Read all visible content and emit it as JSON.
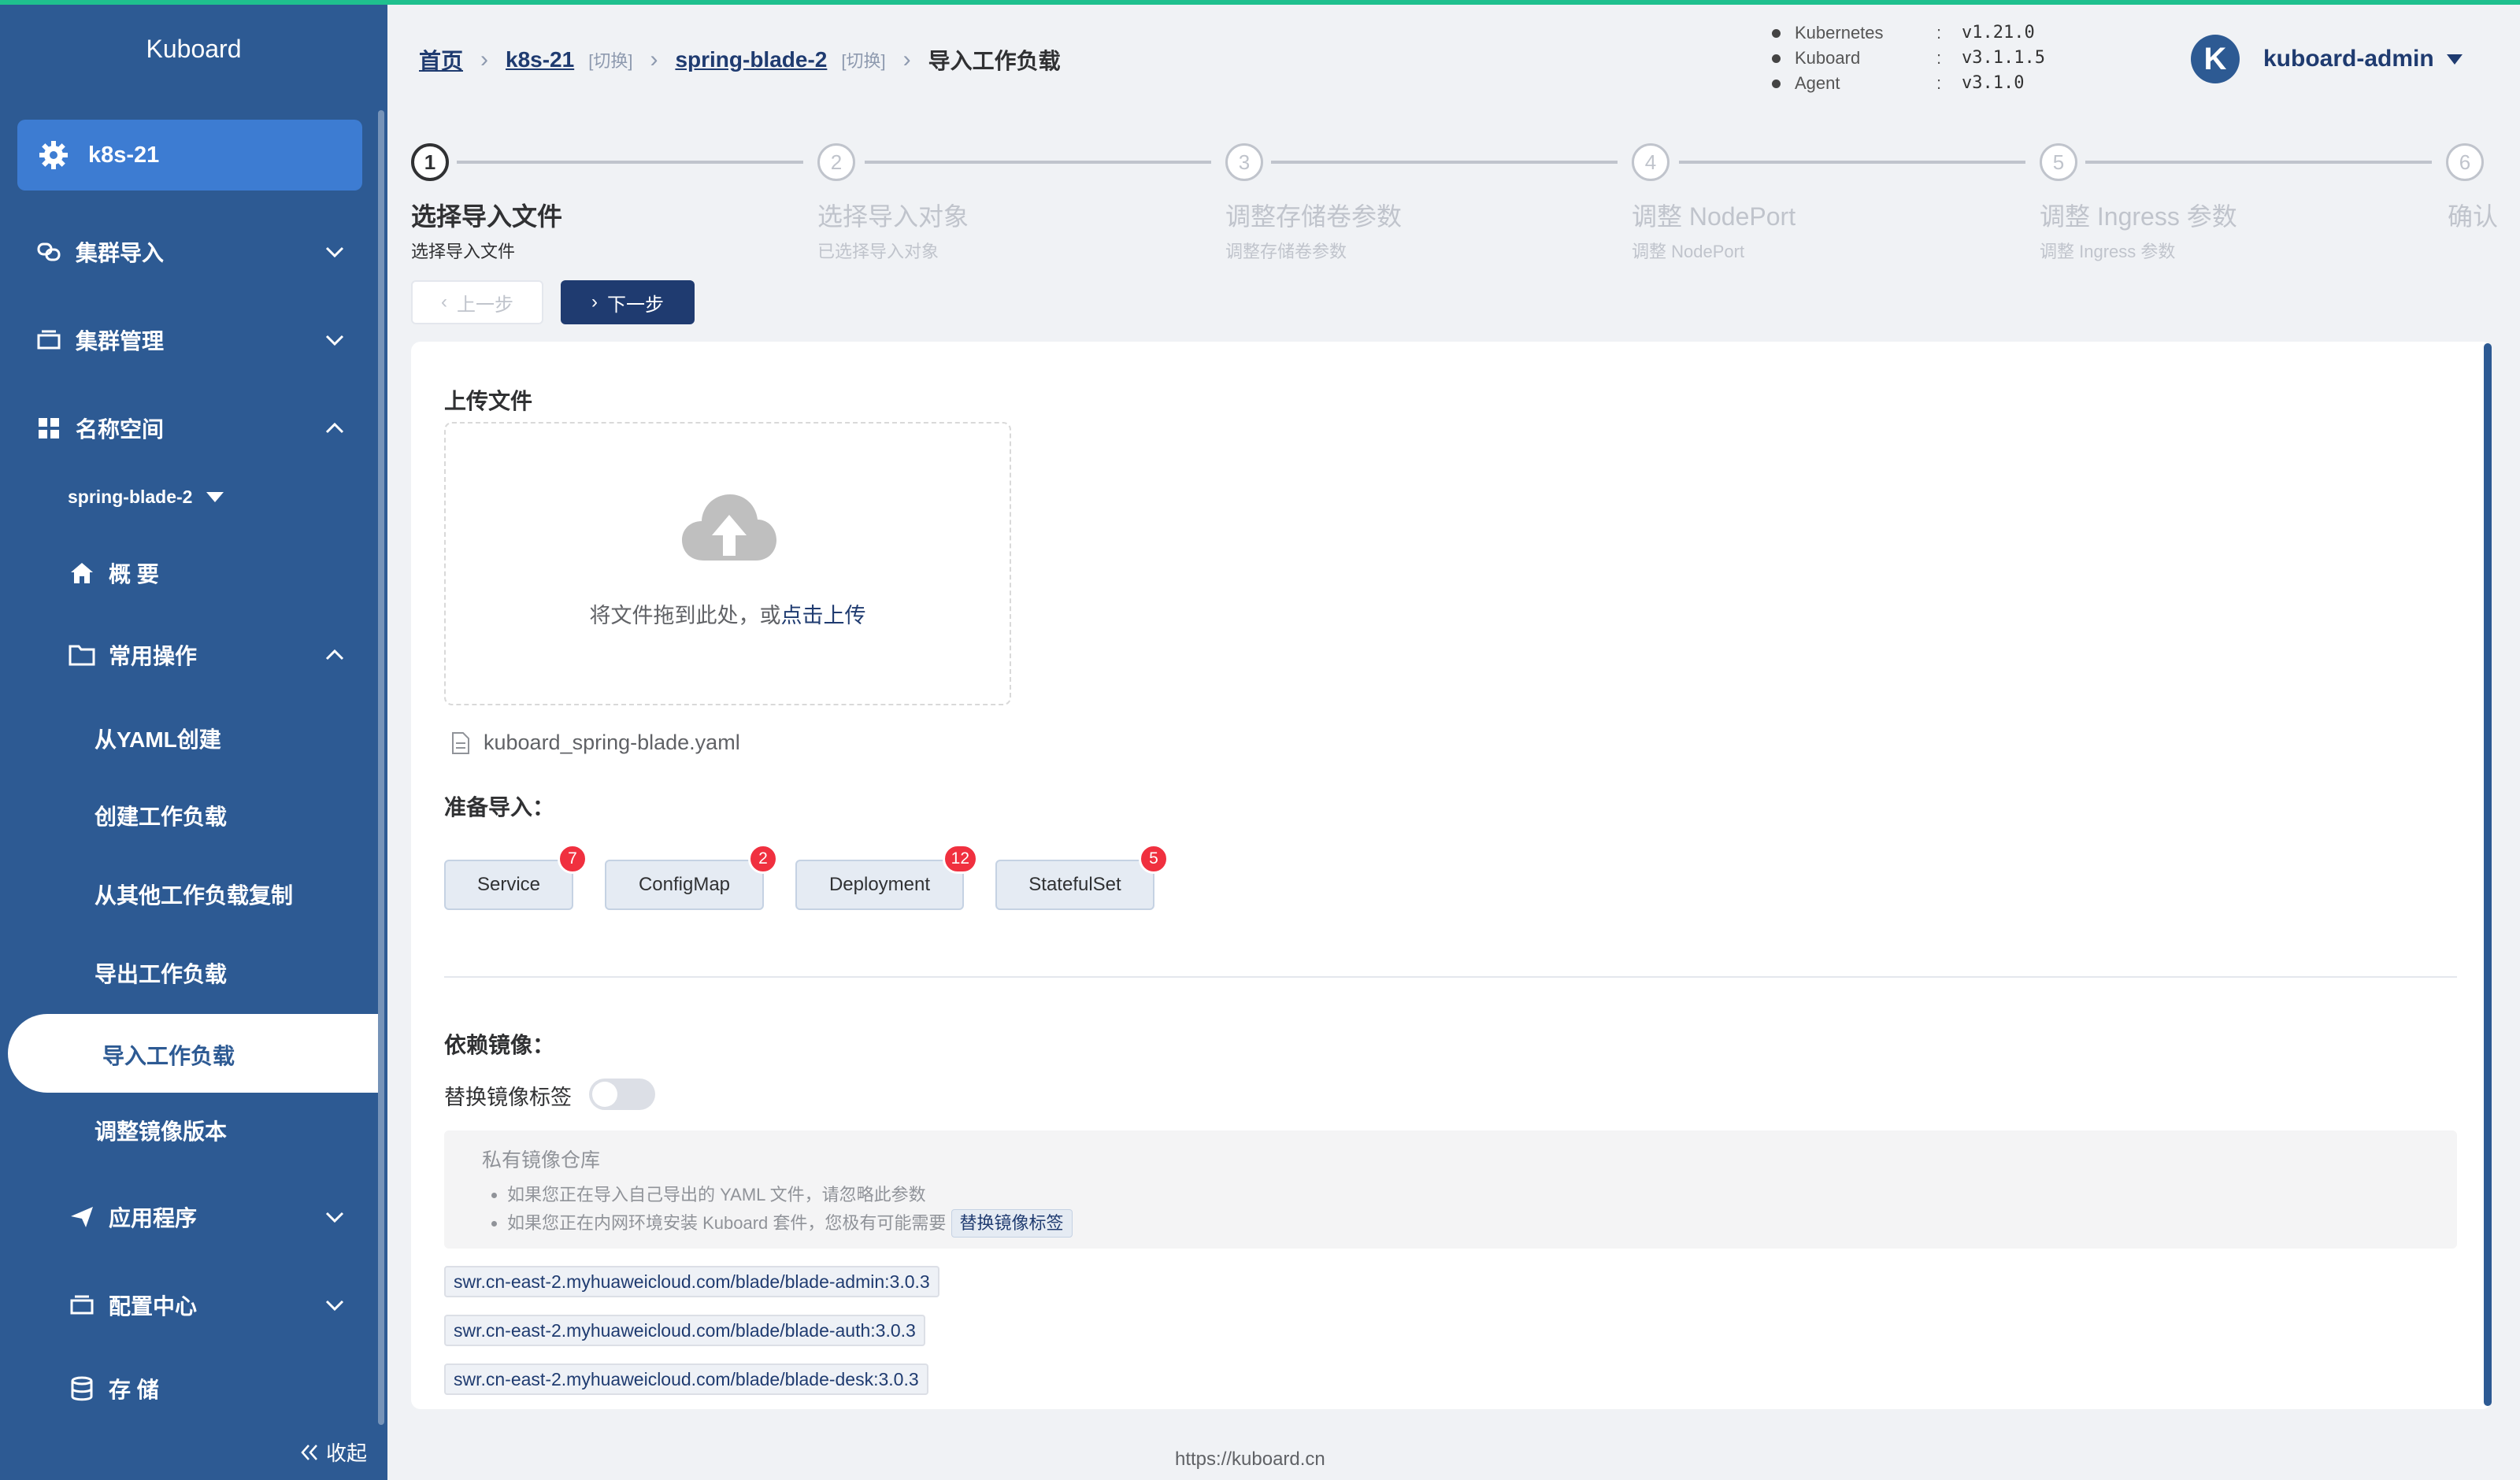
{
  "sidebar": {
    "brand": "Kuboard",
    "cluster": "k8s-21",
    "items": [
      {
        "label": "集群导入"
      },
      {
        "label": "集群管理"
      },
      {
        "label": "名称空间"
      }
    ],
    "namespace": "spring-blade-2",
    "ns_items": {
      "overview": "概 要",
      "common_ops": "常用操作",
      "from_yaml": "从YAML创建",
      "create_workload": "创建工作负载",
      "copy_workload": "从其他工作负载复制",
      "export_workload": "导出工作负载",
      "import_workload": "导入工作负载",
      "adjust_image": "调整镜像版本",
      "apps": "应用程序",
      "config": "配置中心",
      "storage": "存 储"
    },
    "collapse": "收起"
  },
  "header": {
    "breadcrumb": {
      "home": "首页",
      "cluster": "k8s-21",
      "switch1": "[切换]",
      "namespace": "spring-blade-2",
      "switch2": "[切换]",
      "current": "导入工作负载"
    },
    "versions": [
      {
        "name": "Kubernetes",
        "value": "v1.21.0"
      },
      {
        "name": "Kuboard",
        "value": "v3.1.1.5"
      },
      {
        "name": "Agent",
        "value": "v3.1.0"
      }
    ],
    "user": {
      "avatar_letter": "K",
      "name": "kuboard-admin"
    }
  },
  "steps": [
    {
      "num": "1",
      "title": "选择导入文件",
      "desc": "选择导入文件"
    },
    {
      "num": "2",
      "title": "选择导入对象",
      "desc": "已选择导入对象"
    },
    {
      "num": "3",
      "title": "调整存储卷参数",
      "desc": "调整存储卷参数"
    },
    {
      "num": "4",
      "title": "调整 NodePort",
      "desc": "调整 NodePort"
    },
    {
      "num": "5",
      "title": "调整 Ingress 参数",
      "desc": "调整 Ingress 参数"
    },
    {
      "num": "6",
      "title": "确认",
      "desc": ""
    }
  ],
  "buttons": {
    "prev": "上一步",
    "next": "下一步"
  },
  "upload": {
    "title": "上传文件",
    "hint": "将文件拖到此处，或",
    "link": "点击上传",
    "file_name": "kuboard_spring-blade.yaml"
  },
  "prepare": {
    "title": "准备导入：",
    "resources": [
      {
        "label": "Service",
        "count": "7"
      },
      {
        "label": "ConfigMap",
        "count": "2"
      },
      {
        "label": "Deployment",
        "count": "12"
      },
      {
        "label": "StatefulSet",
        "count": "5"
      }
    ]
  },
  "images": {
    "title": "依赖镜像：",
    "toggle_label": "替换镜像标签",
    "toggle_on": false,
    "info_title": "私有镜像仓库",
    "info_line1": "如果您正在导入自己导出的 YAML 文件，请忽略此参数",
    "info_line2": "如果您正在内网环境安装 Kuboard 套件，您极有可能需要",
    "info_tag": "替换镜像标签",
    "list": [
      "swr.cn-east-2.myhuaweicloud.com/blade/blade-admin:3.0.3",
      "swr.cn-east-2.myhuaweicloud.com/blade/blade-auth:3.0.3",
      "swr.cn-east-2.myhuaweicloud.com/blade/blade-desk:3.0.3"
    ]
  },
  "footer": "https://kuboard.cn",
  "colors": {
    "sidebar": "#2d5a93",
    "accent": "#1f3b70",
    "badge": "#f0303f",
    "top_line": "#1fc08e"
  }
}
